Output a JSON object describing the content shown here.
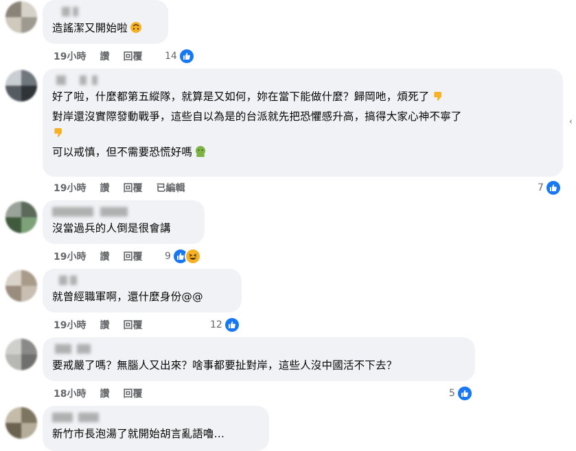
{
  "comments": [
    {
      "lines": [
        "造謠潔又開始啦"
      ],
      "emoji": "upside-down-face",
      "time": "19小時",
      "like": "讚",
      "reply": "回覆",
      "edited": "",
      "reaction_count": "14"
    },
    {
      "lines": [
        "好了啦，什麼都第五縱隊，就算是又如何，妳在當下能做什麼？歸岡吔，煩死了",
        "對岸還沒實際發動戰爭，這些自以為是的台派就先把恐懼感升高，搞得大家心神不寧了",
        "",
        "可以戒慎，但不需要恐慌好嗎"
      ],
      "time": "19小時",
      "like": "讚",
      "reply": "回覆",
      "edited": "已編輯",
      "reaction_count": "7"
    },
    {
      "lines": [
        "沒當過兵的人倒是很會講"
      ],
      "time": "19小時",
      "like": "讚",
      "reply": "回覆",
      "edited": "",
      "reaction_count": "9"
    },
    {
      "lines": [
        "就曾經職軍啊，還什麼身份@@"
      ],
      "time": "19小時",
      "like": "讚",
      "reply": "回覆",
      "edited": "",
      "reaction_count": "12"
    },
    {
      "lines": [
        "要戒嚴了嗎？無腦人又出來？啥事都要扯對岸，這些人沒中國活不下去？"
      ],
      "time": "18小時",
      "like": "讚",
      "reply": "回覆",
      "edited": "",
      "reaction_count": "5"
    },
    {
      "lines": [
        "新竹市長泡湯了就開始胡言亂語嚕…"
      ]
    }
  ],
  "colors": {
    "bubble": "#f0f2f5",
    "meta": "#65676b",
    "like_blue": "#1877f2"
  }
}
